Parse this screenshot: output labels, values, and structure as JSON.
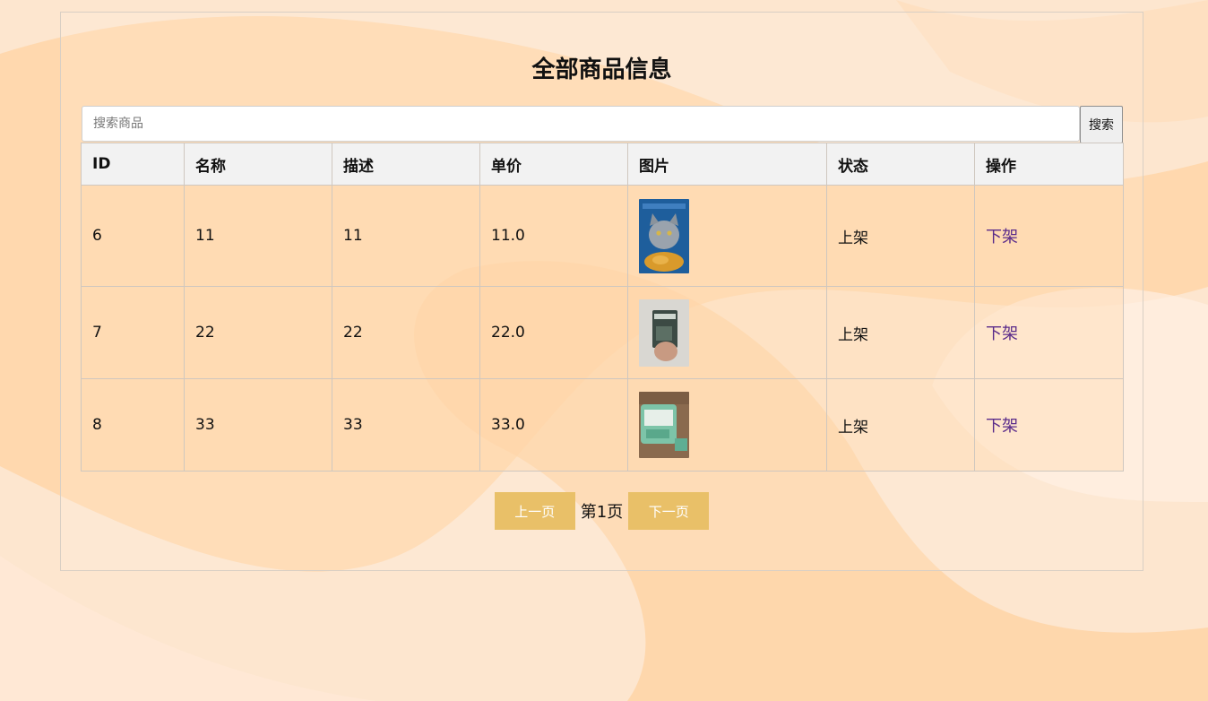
{
  "title": "全部商品信息",
  "search": {
    "placeholder": "搜索商品",
    "value": "",
    "button_label": "搜索"
  },
  "table": {
    "headers": [
      "ID",
      "名称",
      "描述",
      "单价",
      "图片",
      "状态",
      "操作"
    ],
    "rows": [
      {
        "id": "6",
        "name": "11",
        "desc": "11",
        "price": "11.0",
        "image": "cat-food-product-photo",
        "status": "上架",
        "action": "下架"
      },
      {
        "id": "7",
        "name": "22",
        "desc": "22",
        "price": "22.0",
        "image": "snack-bag-product-photo",
        "status": "上架",
        "action": "下架"
      },
      {
        "id": "8",
        "name": "33",
        "desc": "33",
        "price": "33.0",
        "image": "green-package-product-photo",
        "status": "上架",
        "action": "下架"
      }
    ]
  },
  "pagination": {
    "prev_label": "上一页",
    "page_text": "第1页",
    "next_label": "下一页"
  },
  "colors": {
    "background": "#fde6cf",
    "accent": "#e9c068",
    "link": "#5a2b8a",
    "header_bg": "#f2f2f2"
  }
}
